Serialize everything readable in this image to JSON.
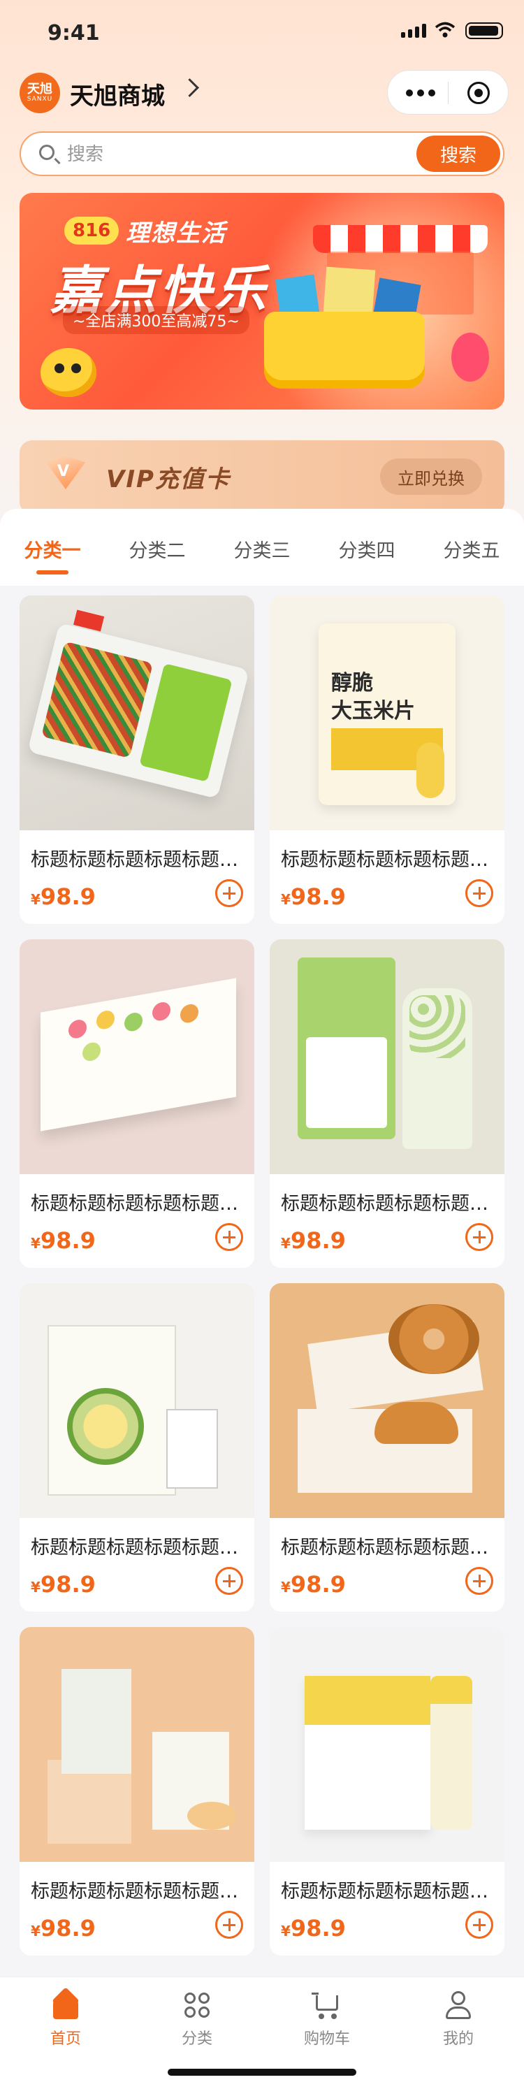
{
  "status_bar": {
    "time": "9:41"
  },
  "header": {
    "logo_text": "天旭",
    "logo_sub": "SANXU",
    "store_name": "天旭商城"
  },
  "search": {
    "placeholder": "搜索",
    "button_label": "搜索"
  },
  "banner": {
    "tag": "816",
    "subtitle": "理想生活",
    "title": "嘉点快乐",
    "promo": "~全店满300至高减75~"
  },
  "vip": {
    "label": "VIP充值卡",
    "redeem_label": "立即兑换"
  },
  "tabs": [
    "分类一",
    "分类二",
    "分类三",
    "分类四",
    "分类五"
  ],
  "active_tab": 0,
  "products": [
    {
      "name": "标题标题标题标题标题标题",
      "currency": "¥",
      "price": "98.9"
    },
    {
      "name": "标题标题标题标题标题标题",
      "currency": "¥",
      "price": "98.9"
    },
    {
      "name": "标题标题标题标题标题标题",
      "currency": "¥",
      "price": "98.9"
    },
    {
      "name": "标题标题标题标题标题标题",
      "currency": "¥",
      "price": "98.9"
    },
    {
      "name": "标题标题标题标题标题标题",
      "currency": "¥",
      "price": "98.9"
    },
    {
      "name": "标题标题标题标题标题标题",
      "currency": "¥",
      "price": "98.9"
    },
    {
      "name": "标题标题标题标题标题标题",
      "currency": "¥",
      "price": "98.9"
    },
    {
      "name": "标题标题标题标题标题标题",
      "currency": "¥",
      "price": "98.9"
    }
  ],
  "product_images": [
    {
      "text1": "",
      "text2": ""
    },
    {
      "text1": "醇脆",
      "text2": "大玉米片"
    },
    {
      "text1": "",
      "text2": ""
    },
    {
      "text1": "",
      "text2": ""
    },
    {
      "text1": "",
      "text2": ""
    },
    {
      "text1": "",
      "text2": ""
    },
    {
      "text1": "",
      "text2": ""
    },
    {
      "text1": "",
      "text2": ""
    }
  ],
  "tabbar": [
    {
      "label": "首页",
      "icon": "home-icon"
    },
    {
      "label": "分类",
      "icon": "category-icon"
    },
    {
      "label": "购物车",
      "icon": "cart-icon"
    },
    {
      "label": "我的",
      "icon": "user-icon"
    }
  ],
  "colors": {
    "accent": "#f2661a",
    "background": "#f5f5f7"
  }
}
